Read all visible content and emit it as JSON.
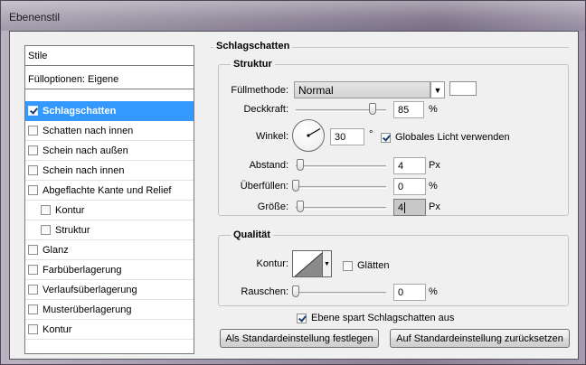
{
  "window": {
    "title": "Ebenenstil"
  },
  "styles_panel": {
    "header": "Stile",
    "fill_options": "Fülloptionen: Eigene",
    "items": [
      {
        "label": "Schlagschatten",
        "checked": true,
        "selected": true
      },
      {
        "label": "Schatten nach innen",
        "checked": false
      },
      {
        "label": "Schein nach außen",
        "checked": false
      },
      {
        "label": "Schein nach innen",
        "checked": false
      },
      {
        "label": "Abgeflachte Kante und Relief",
        "checked": false
      },
      {
        "label": "Kontur",
        "checked": false,
        "indent": true
      },
      {
        "label": "Struktur",
        "checked": false,
        "indent": true
      },
      {
        "label": "Glanz",
        "checked": false
      },
      {
        "label": "Farbüberlagerung",
        "checked": false
      },
      {
        "label": "Verlaufsüberlagerung",
        "checked": false
      },
      {
        "label": "Musterüberlagerung",
        "checked": false
      },
      {
        "label": "Kontur",
        "checked": false
      }
    ]
  },
  "drop_shadow": {
    "title": "Schlagschatten",
    "structure": {
      "title": "Struktur",
      "blend_mode_label": "Füllmethode:",
      "blend_mode_value": "Normal",
      "opacity_label": "Deckkraft:",
      "opacity_value": "85",
      "opacity_unit": "%",
      "opacity_level": 0.85,
      "angle_label": "Winkel:",
      "angle_value": "30",
      "angle_unit": "°",
      "global_light_label": "Globales Licht verwenden",
      "global_light_checked": true,
      "distance_label": "Abstand:",
      "distance_value": "4",
      "distance_unit": "Px",
      "spread_label": "Überfüllen:",
      "spread_value": "0",
      "spread_unit": "%",
      "size_label": "Größe:",
      "size_value": "4",
      "size_unit": "Px"
    },
    "quality": {
      "title": "Qualität",
      "contour_label": "Kontur:",
      "antialias_label": "Glätten",
      "antialias_checked": false,
      "noise_label": "Rauschen:",
      "noise_value": "0",
      "noise_unit": "%"
    },
    "knockout_label": "Ebene spart Schlagschatten aus",
    "knockout_checked": true,
    "make_default_button": "Als Standardeinstellung festlegen",
    "reset_default_button": "Auf Standardeinstellung zurücksetzen"
  },
  "colors": {
    "selection": "#3399ff",
    "shadow_color": "#ffffff"
  }
}
